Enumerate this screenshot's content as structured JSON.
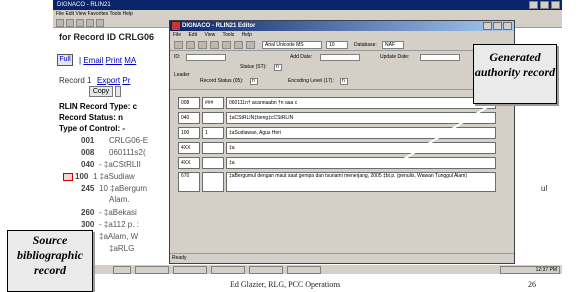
{
  "back_window": {
    "title": "DIGNACO - RLIN21",
    "menu": "File Edit View Favorites Tools Help",
    "heading": "for Record ID CRLG06",
    "full_button": "Full",
    "links": [
      "Email",
      "Print",
      "MA"
    ],
    "record_label": "Record 1",
    "export_link": "Export",
    "export_suffix": "Pr",
    "copy_button": "Copy",
    "record_type": "RLIN Record Type: c",
    "record_status": "Record Status: n",
    "type_of_control": "Type of Control: -",
    "fields": [
      {
        "tag": "001",
        "value": "CRLG06-E"
      },
      {
        "tag": "008",
        "value": "060111s2("
      },
      {
        "tag": "040",
        "value": "- ‡aCStRLII"
      },
      {
        "tag": "100",
        "value": "1  ‡aSudiaw"
      },
      {
        "tag": "245",
        "value": "10 ‡aBergum"
      },
      {
        "tag": "",
        "value": "Alam."
      },
      {
        "tag": "260",
        "value": "- ‡aBekasi"
      },
      {
        "tag": "300",
        "value": "- ‡a112 p. :"
      },
      {
        "tag": "",
        "value": "‡aAlam, W"
      },
      {
        "tag": "",
        "value": "‡aRLG"
      }
    ],
    "right_edge_text": "ul"
  },
  "editor": {
    "title": "DIGNACO - RLIN21 Editor",
    "menu": [
      "File",
      "Edit",
      "View",
      "Tools",
      "Help"
    ],
    "font_name": "Arial Unicode MS",
    "font_size": "10",
    "database_label": "Database:",
    "database_value": "NAF",
    "fixed_fields": {
      "id_label": "ID:",
      "add_date_label": "Add Date:",
      "update_date_label": "Update Date:",
      "status_label": "Status (ST):",
      "status_value": "n",
      "leader_label": "Leader",
      "record_status_label": "Record Status (05):",
      "record_status_value": "n",
      "encoding_label": "Encoding Level (17):",
      "encoding_value": "n"
    },
    "rows": [
      {
        "tag": "008",
        "ind": "###",
        "content": "060111n† acannaabn        †n aaa    c"
      },
      {
        "tag": "040",
        "ind": "",
        "content": "‡aCStRLIN‡beng‡cCStRLIN"
      },
      {
        "tag": "100",
        "ind": "1",
        "content": "‡aSudiawan, Agus Heri"
      },
      {
        "tag": "4XX",
        "ind": "",
        "content": "‡a"
      },
      {
        "tag": "4XX",
        "ind": "",
        "content": "‡a"
      },
      {
        "tag": "670",
        "ind": "",
        "content": "‡aBergumul dengan maut saat gempa dan tsunami menerjang, 2005 ‡bt.p. (penulis, Wawan Tunggul Alam)"
      }
    ],
    "status_bar": "Ready"
  },
  "taskbar": {
    "items": [
      "",
      "",
      "",
      "",
      "",
      ""
    ],
    "clock": "12:37 PM"
  },
  "callouts": {
    "authority": "Generated authority record",
    "source": "Source bibliographic record"
  },
  "footer": {
    "text": "Ed Glazier, RLG, PCC Operations",
    "page": "26"
  }
}
